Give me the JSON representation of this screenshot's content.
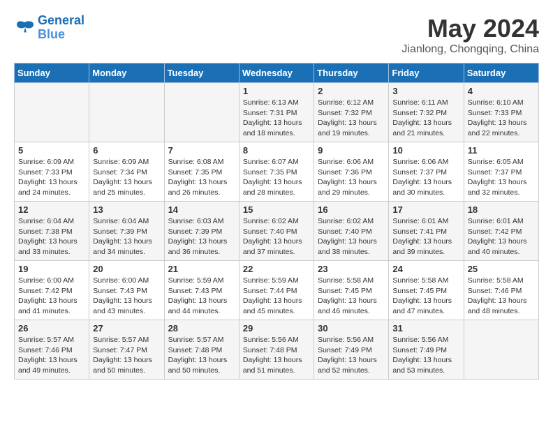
{
  "header": {
    "logo_line1": "General",
    "logo_line2": "Blue",
    "title": "May 2024",
    "subtitle": "Jianlong, Chongqing, China"
  },
  "days_of_week": [
    "Sunday",
    "Monday",
    "Tuesday",
    "Wednesday",
    "Thursday",
    "Friday",
    "Saturday"
  ],
  "weeks": [
    [
      {
        "day": "",
        "content": ""
      },
      {
        "day": "",
        "content": ""
      },
      {
        "day": "",
        "content": ""
      },
      {
        "day": "1",
        "content": "Sunrise: 6:13 AM\nSunset: 7:31 PM\nDaylight: 13 hours and 18 minutes."
      },
      {
        "day": "2",
        "content": "Sunrise: 6:12 AM\nSunset: 7:32 PM\nDaylight: 13 hours and 19 minutes."
      },
      {
        "day": "3",
        "content": "Sunrise: 6:11 AM\nSunset: 7:32 PM\nDaylight: 13 hours and 21 minutes."
      },
      {
        "day": "4",
        "content": "Sunrise: 6:10 AM\nSunset: 7:33 PM\nDaylight: 13 hours and 22 minutes."
      }
    ],
    [
      {
        "day": "5",
        "content": "Sunrise: 6:09 AM\nSunset: 7:33 PM\nDaylight: 13 hours and 24 minutes."
      },
      {
        "day": "6",
        "content": "Sunrise: 6:09 AM\nSunset: 7:34 PM\nDaylight: 13 hours and 25 minutes."
      },
      {
        "day": "7",
        "content": "Sunrise: 6:08 AM\nSunset: 7:35 PM\nDaylight: 13 hours and 26 minutes."
      },
      {
        "day": "8",
        "content": "Sunrise: 6:07 AM\nSunset: 7:35 PM\nDaylight: 13 hours and 28 minutes."
      },
      {
        "day": "9",
        "content": "Sunrise: 6:06 AM\nSunset: 7:36 PM\nDaylight: 13 hours and 29 minutes."
      },
      {
        "day": "10",
        "content": "Sunrise: 6:06 AM\nSunset: 7:37 PM\nDaylight: 13 hours and 30 minutes."
      },
      {
        "day": "11",
        "content": "Sunrise: 6:05 AM\nSunset: 7:37 PM\nDaylight: 13 hours and 32 minutes."
      }
    ],
    [
      {
        "day": "12",
        "content": "Sunrise: 6:04 AM\nSunset: 7:38 PM\nDaylight: 13 hours and 33 minutes."
      },
      {
        "day": "13",
        "content": "Sunrise: 6:04 AM\nSunset: 7:39 PM\nDaylight: 13 hours and 34 minutes."
      },
      {
        "day": "14",
        "content": "Sunrise: 6:03 AM\nSunset: 7:39 PM\nDaylight: 13 hours and 36 minutes."
      },
      {
        "day": "15",
        "content": "Sunrise: 6:02 AM\nSunset: 7:40 PM\nDaylight: 13 hours and 37 minutes."
      },
      {
        "day": "16",
        "content": "Sunrise: 6:02 AM\nSunset: 7:40 PM\nDaylight: 13 hours and 38 minutes."
      },
      {
        "day": "17",
        "content": "Sunrise: 6:01 AM\nSunset: 7:41 PM\nDaylight: 13 hours and 39 minutes."
      },
      {
        "day": "18",
        "content": "Sunrise: 6:01 AM\nSunset: 7:42 PM\nDaylight: 13 hours and 40 minutes."
      }
    ],
    [
      {
        "day": "19",
        "content": "Sunrise: 6:00 AM\nSunset: 7:42 PM\nDaylight: 13 hours and 41 minutes."
      },
      {
        "day": "20",
        "content": "Sunrise: 6:00 AM\nSunset: 7:43 PM\nDaylight: 13 hours and 43 minutes."
      },
      {
        "day": "21",
        "content": "Sunrise: 5:59 AM\nSunset: 7:43 PM\nDaylight: 13 hours and 44 minutes."
      },
      {
        "day": "22",
        "content": "Sunrise: 5:59 AM\nSunset: 7:44 PM\nDaylight: 13 hours and 45 minutes."
      },
      {
        "day": "23",
        "content": "Sunrise: 5:58 AM\nSunset: 7:45 PM\nDaylight: 13 hours and 46 minutes."
      },
      {
        "day": "24",
        "content": "Sunrise: 5:58 AM\nSunset: 7:45 PM\nDaylight: 13 hours and 47 minutes."
      },
      {
        "day": "25",
        "content": "Sunrise: 5:58 AM\nSunset: 7:46 PM\nDaylight: 13 hours and 48 minutes."
      }
    ],
    [
      {
        "day": "26",
        "content": "Sunrise: 5:57 AM\nSunset: 7:46 PM\nDaylight: 13 hours and 49 minutes."
      },
      {
        "day": "27",
        "content": "Sunrise: 5:57 AM\nSunset: 7:47 PM\nDaylight: 13 hours and 50 minutes."
      },
      {
        "day": "28",
        "content": "Sunrise: 5:57 AM\nSunset: 7:48 PM\nDaylight: 13 hours and 50 minutes."
      },
      {
        "day": "29",
        "content": "Sunrise: 5:56 AM\nSunset: 7:48 PM\nDaylight: 13 hours and 51 minutes."
      },
      {
        "day": "30",
        "content": "Sunrise: 5:56 AM\nSunset: 7:49 PM\nDaylight: 13 hours and 52 minutes."
      },
      {
        "day": "31",
        "content": "Sunrise: 5:56 AM\nSunset: 7:49 PM\nDaylight: 13 hours and 53 minutes."
      },
      {
        "day": "",
        "content": ""
      }
    ]
  ]
}
